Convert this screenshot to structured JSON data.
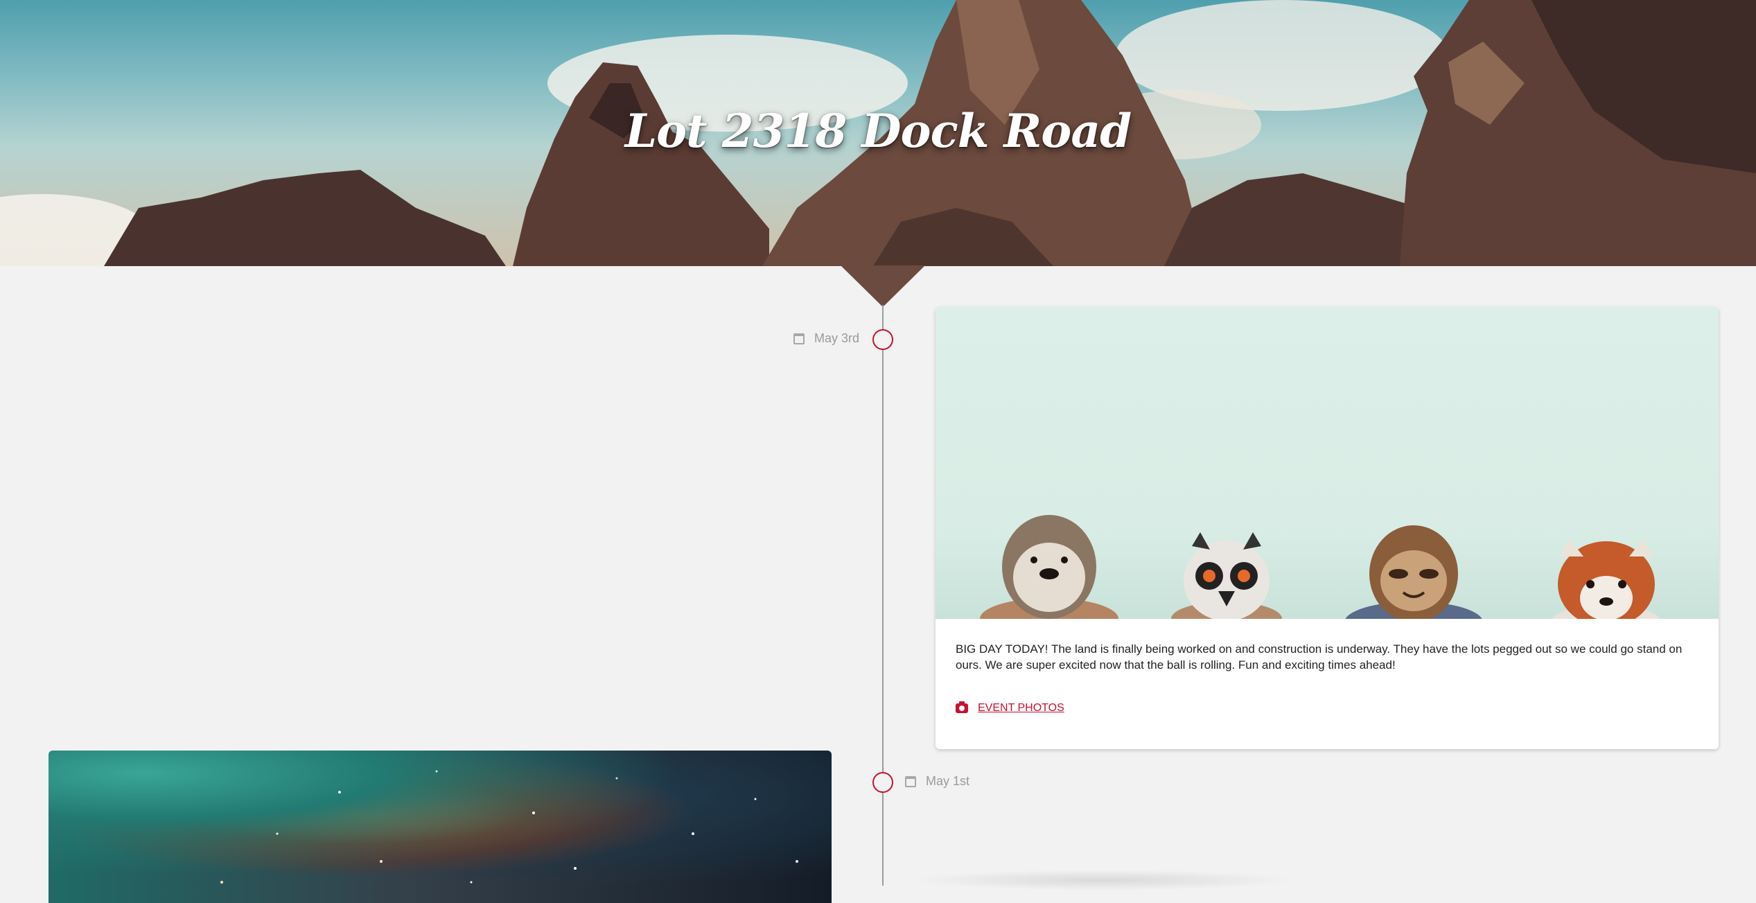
{
  "header": {
    "title": "Lot 2318 Dock Road"
  },
  "timeline": {
    "entries": [
      {
        "date": "May 3rd",
        "text": "BIG DAY TODAY! The land is finally being worked on and construction is underway. They have the lots pegged out so we could go stand on ours. We are super excited now that the ball is rolling. Fun and exciting times ahead!",
        "link_label": "EVENT PHOTOS",
        "link_icon": "camera-icon",
        "image_subject": "animals"
      },
      {
        "date": "May 1st",
        "image_subject": "nebula"
      }
    ]
  },
  "colors": {
    "accent": "#c8102e",
    "background": "#f2f2f2",
    "timeline_line": "#9c9c9c",
    "date_text": "#9a9a9a"
  }
}
